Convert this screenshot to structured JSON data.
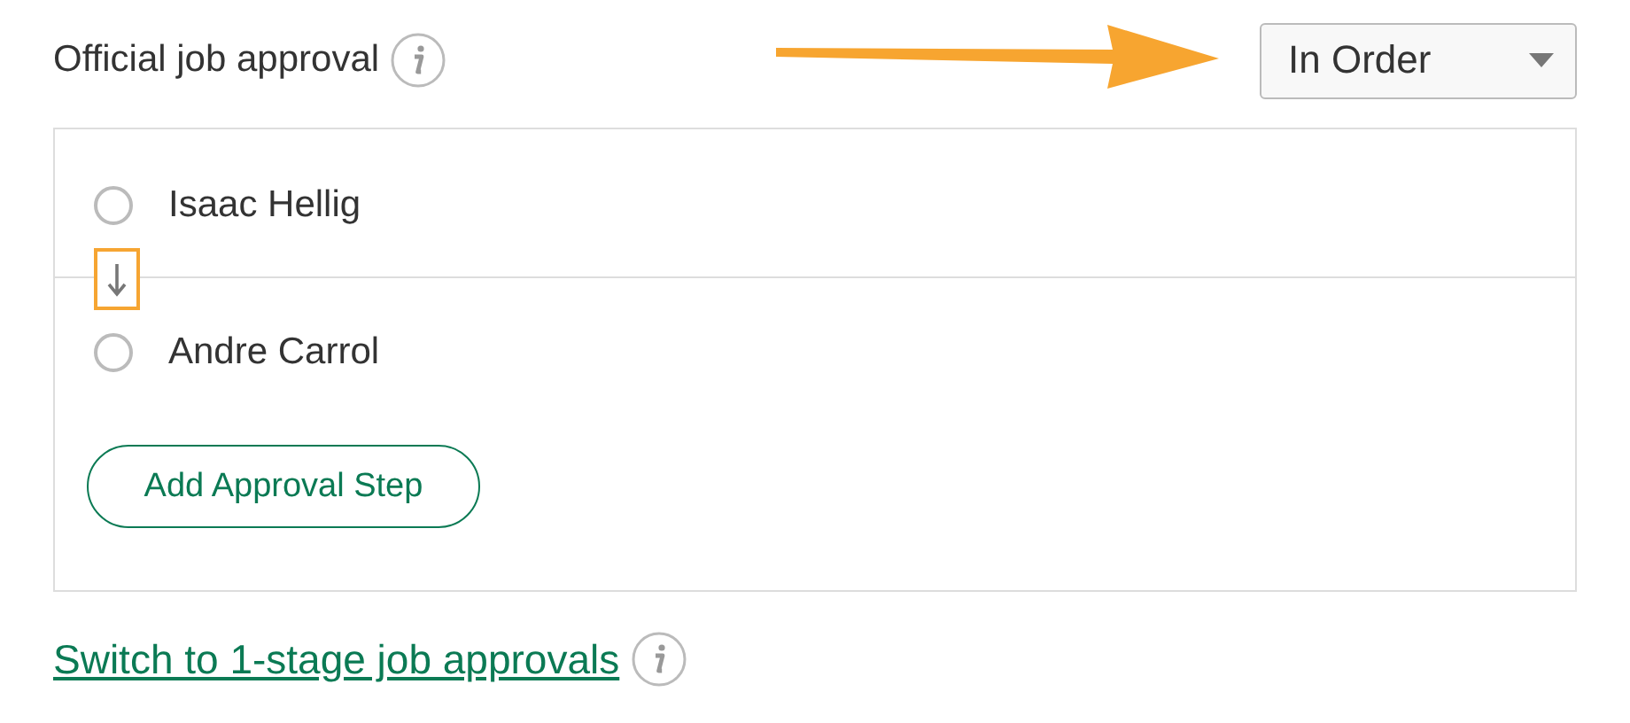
{
  "header": {
    "title": "Official job approval",
    "order_select": {
      "value": "In Order"
    }
  },
  "approvers": [
    {
      "name": "Isaac Hellig",
      "selected": false
    },
    {
      "name": "Andre Carrol",
      "selected": false
    }
  ],
  "add_button": "Add Approval Step",
  "switch_link": "Switch to 1-stage job approvals"
}
